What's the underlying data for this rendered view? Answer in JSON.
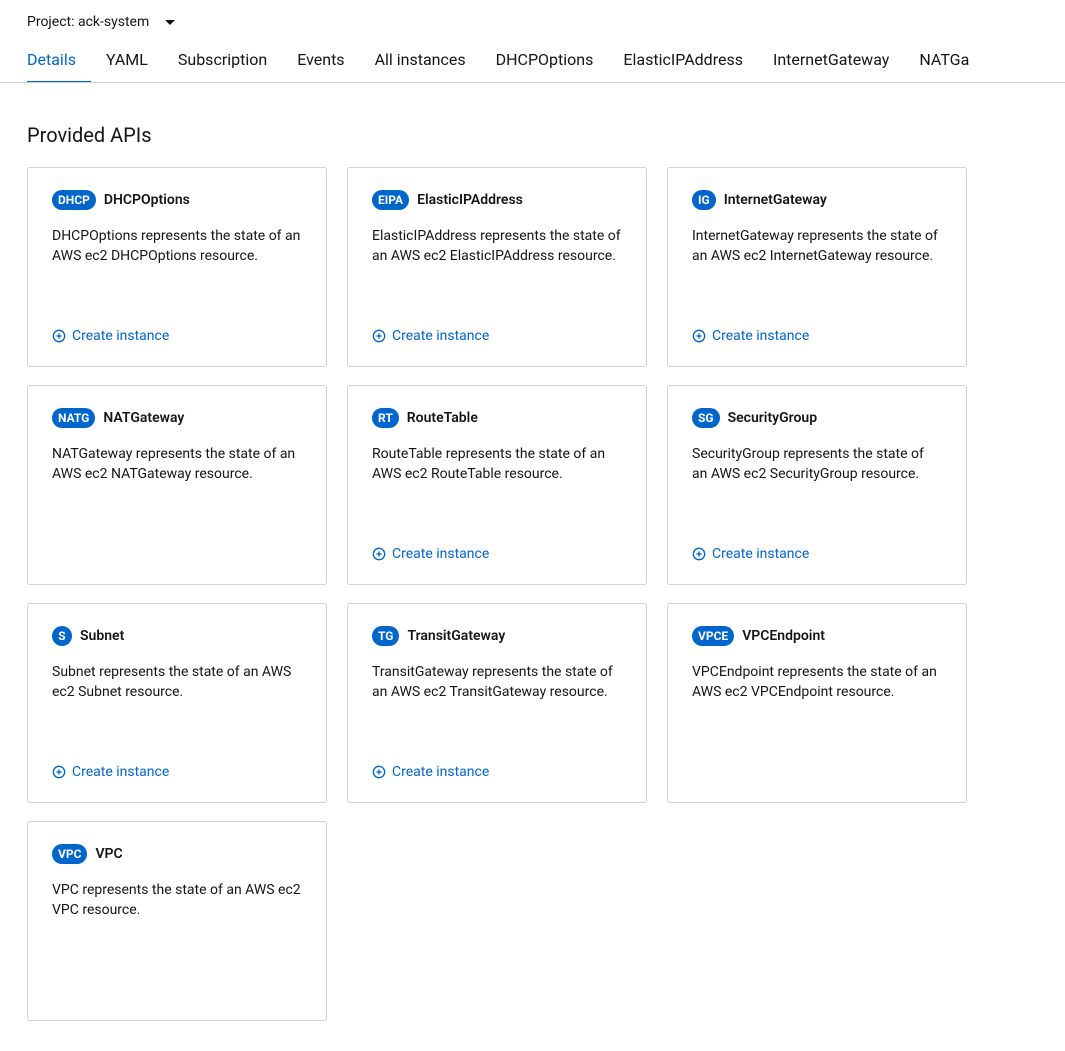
{
  "project": {
    "label": "Project: ack-system"
  },
  "tabs": [
    {
      "label": "Details",
      "active": true
    },
    {
      "label": "YAML"
    },
    {
      "label": "Subscription"
    },
    {
      "label": "Events"
    },
    {
      "label": "All instances"
    },
    {
      "label": "DHCPOptions"
    },
    {
      "label": "ElasticIPAddress"
    },
    {
      "label": "InternetGateway"
    },
    {
      "label": "NATGa"
    }
  ],
  "section_title": "Provided APIs",
  "create_label": "Create instance",
  "apis": [
    {
      "badge": "DHCP",
      "title": "DHCPOptions",
      "desc": "DHCPOptions represents the state of an AWS ec2 DHCPOptions resource.",
      "create": true
    },
    {
      "badge": "EIPA",
      "title": "ElasticIPAddress",
      "desc": "ElasticIPAddress represents the state of an AWS ec2 ElasticIPAddress resource.",
      "create": true
    },
    {
      "badge": "IG",
      "title": "InternetGateway",
      "desc": "InternetGateway represents the state of an AWS ec2 InternetGateway resource.",
      "create": true
    },
    {
      "badge": "NATG",
      "title": "NATGateway",
      "desc": "NATGateway represents the state of an AWS ec2 NATGateway resource.",
      "create": false
    },
    {
      "badge": "RT",
      "title": "RouteTable",
      "desc": "RouteTable represents the state of an AWS ec2 RouteTable resource.",
      "create": true
    },
    {
      "badge": "SG",
      "title": "SecurityGroup",
      "desc": "SecurityGroup represents the state of an AWS ec2 SecurityGroup resource.",
      "create": true
    },
    {
      "badge": "S",
      "title": "Subnet",
      "desc": "Subnet represents the state of an AWS ec2 Subnet resource.",
      "create": true
    },
    {
      "badge": "TG",
      "title": "TransitGateway",
      "desc": "TransitGateway represents the state of an AWS ec2 TransitGateway resource.",
      "create": true
    },
    {
      "badge": "VPCE",
      "title": "VPCEndpoint",
      "desc": "VPCEndpoint represents the state of an AWS ec2 VPCEndpoint resource.",
      "create": false
    },
    {
      "badge": "VPC",
      "title": "VPC",
      "desc": "VPC represents the state of an AWS ec2 VPC resource.",
      "create": false
    }
  ]
}
